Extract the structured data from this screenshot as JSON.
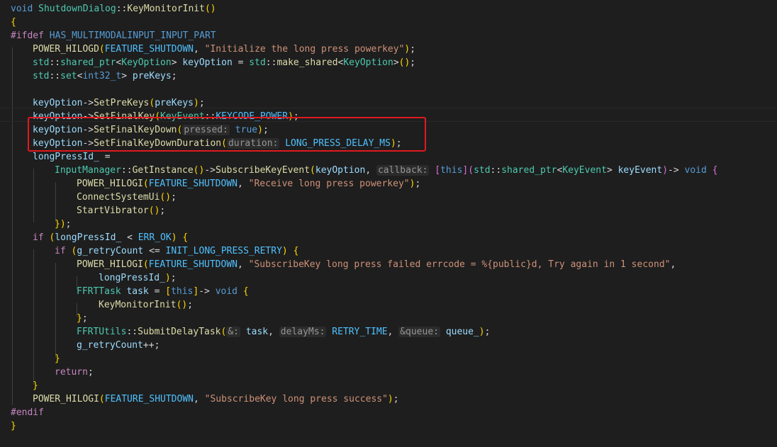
{
  "editor": {
    "lines": [
      "void ShutdownDialog::KeyMonitorInit()",
      "{",
      "#ifdef HAS_MULTIMODALINPUT_INPUT_PART",
      "POWER_HILOGD(FEATURE_SHUTDOWN, \"Initialize the long press powerkey\");",
      "std::shared_ptr<KeyOption> keyOption = std::make_shared<KeyOption>();",
      "std::set<int32_t> preKeys;",
      "",
      "keyOption->SetPreKeys(preKeys);",
      "keyOption->SetFinalKey(KeyEvent::KEYCODE_POWER);",
      "keyOption->SetFinalKeyDown(pressed: true);",
      "keyOption->SetFinalKeyDownDuration(duration: LONG_PRESS_DELAY_MS);",
      "longPressId_ =",
      "InputManager::GetInstance()->SubscribeKeyEvent(keyOption, callback: [this](std::shared_ptr<KeyEvent> keyEvent)-> void {",
      "POWER_HILOGI(FEATURE_SHUTDOWN, \"Receive long press powerkey\");",
      "ConnectSystemUi();",
      "StartVibrator();",
      "});",
      "if (longPressId_ < ERR_OK) {",
      "if (g_retryCount <= INIT_LONG_PRESS_RETRY) {",
      "POWER_HILOGI(FEATURE_SHUTDOWN, \"SubscribeKey long press failed errcode = %{public}d, Try again in 1 second\",",
      "longPressId_);",
      "FFRTTask task = [this]-> void {",
      "KeyMonitorInit();",
      "};",
      "FFRTUtils::SubmitDelayTask(&: task, delayMs: RETRY_TIME, &queue: queue_);",
      "g_retryCount++;",
      "}",
      "return;",
      "}",
      "POWER_HILOGI(FEATURE_SHUTDOWN, \"SubscribeKey long press success\");",
      "#endif",
      "}"
    ]
  },
  "colors": {
    "background": "#1e1e1e",
    "highlight_box": "#e0191f"
  }
}
